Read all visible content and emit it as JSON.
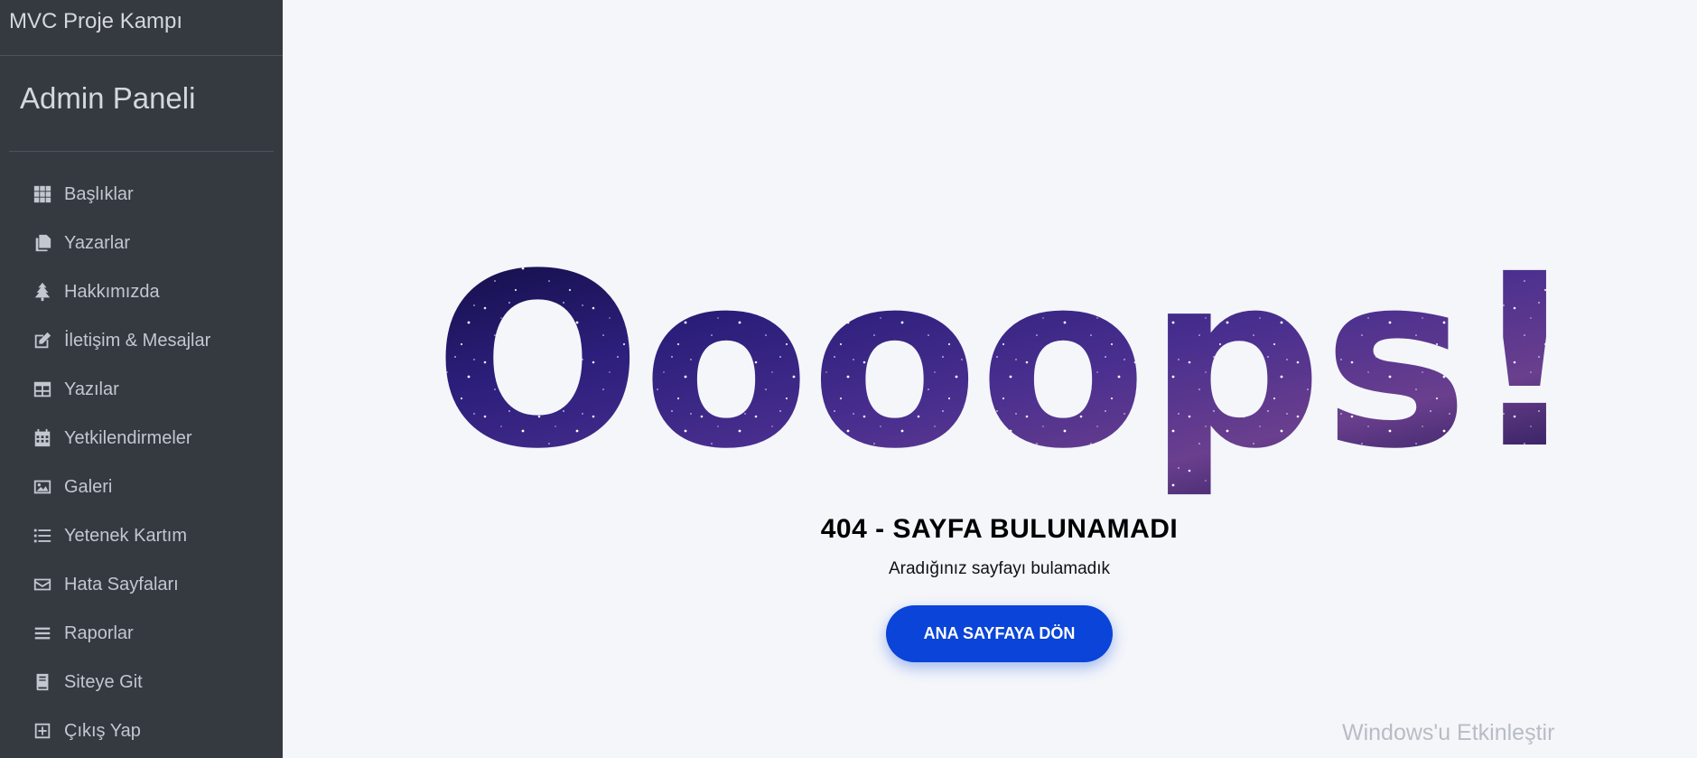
{
  "sidebar": {
    "brand": "MVC Proje Kampı",
    "panel_title": "Admin Paneli",
    "items": [
      {
        "label": "Başlıklar",
        "icon": "grid-icon"
      },
      {
        "label": "Yazarlar",
        "icon": "copy-icon"
      },
      {
        "label": "Hakkımızda",
        "icon": "tree-icon"
      },
      {
        "label": "İletişim & Mesajlar",
        "icon": "edit-icon"
      },
      {
        "label": "Yazılar",
        "icon": "table-icon"
      },
      {
        "label": "Yetkilendirmeler",
        "icon": "calendar-icon"
      },
      {
        "label": "Galeri",
        "icon": "image-icon"
      },
      {
        "label": "Yetenek Kartım",
        "icon": "list-icon"
      },
      {
        "label": "Hata Sayfaları",
        "icon": "envelope-icon"
      },
      {
        "label": "Raporlar",
        "icon": "bars-icon"
      },
      {
        "label": "Siteye Git",
        "icon": "book-icon"
      },
      {
        "label": "Çıkış Yap",
        "icon": "plus-square-icon"
      }
    ]
  },
  "main": {
    "headline": "Oooops!",
    "error_title": "404 - SAYFA BULUNAMADI",
    "error_subtitle": "Aradığınız sayfayı bulamadık",
    "home_button": "ANA SAYFAYA DÖN"
  },
  "watermark": "Windows'u Etkinleştir",
  "colors": {
    "sidebar_bg": "#343a40",
    "main_bg": "#f4f6fa",
    "button_bg": "#0a44d8",
    "headline_fill": "#2a1d6b"
  }
}
